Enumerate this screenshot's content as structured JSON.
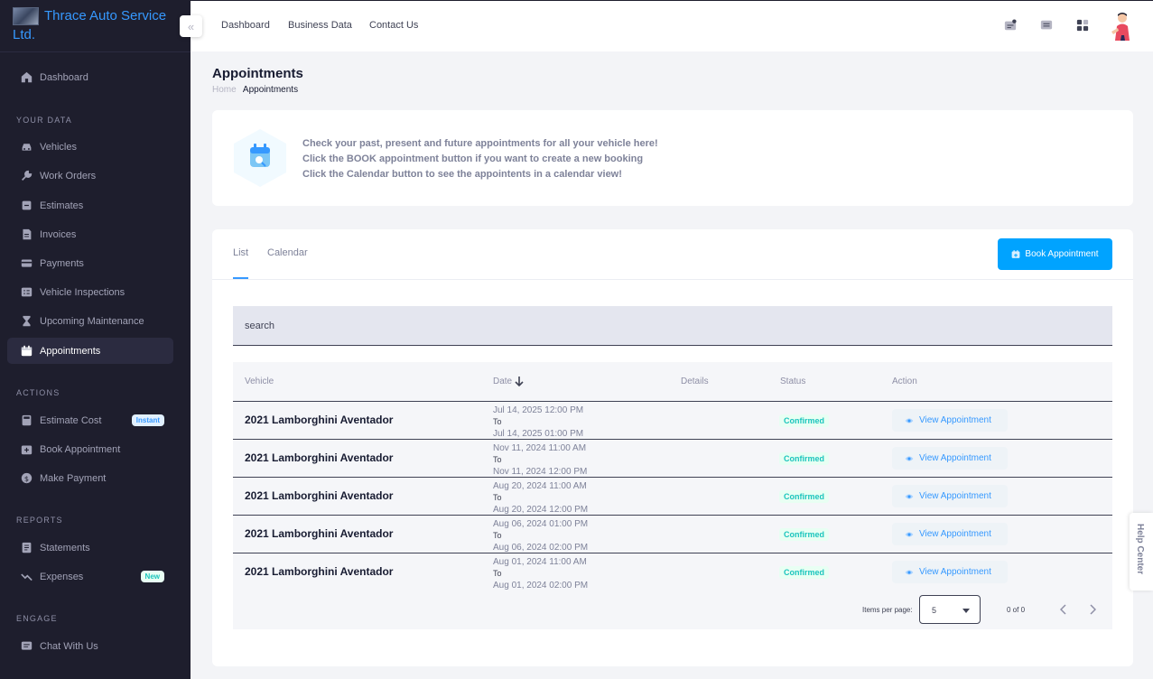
{
  "brand": {
    "name_line1": "Thrace Auto Service",
    "name_line2": "Ltd."
  },
  "sidebar": {
    "items": [
      {
        "label": "Dashboard",
        "icon": "home-icon"
      },
      {
        "label": "Vehicles",
        "icon": "car-icon"
      },
      {
        "label": "Work Orders",
        "icon": "wrench-icon"
      },
      {
        "label": "Estimates",
        "icon": "estimate-icon"
      },
      {
        "label": "Invoices",
        "icon": "invoice-icon"
      },
      {
        "label": "Payments",
        "icon": "payment-icon"
      },
      {
        "label": "Vehicle Inspections",
        "icon": "checklist-icon"
      },
      {
        "label": "Upcoming Maintenance",
        "icon": "hourglass-icon"
      },
      {
        "label": "Appointments",
        "icon": "calendar-icon",
        "active": true
      },
      {
        "label": "Estimate Cost",
        "icon": "calculator-icon",
        "badge": "Instant"
      },
      {
        "label": "Book Appointment",
        "icon": "book-icon"
      },
      {
        "label": "Make Payment",
        "icon": "dollar-icon"
      },
      {
        "label": "Statements",
        "icon": "statement-icon"
      },
      {
        "label": "Expenses",
        "icon": "expense-icon",
        "badge": "New"
      },
      {
        "label": "Chat With Us",
        "icon": "chat-icon"
      }
    ],
    "sections": {
      "your_data": "YOUR DATA",
      "actions": "ACTIONS",
      "reports": "REPORTS",
      "engage": "ENGAGE"
    }
  },
  "header": {
    "links": [
      "Dashboard",
      "Business Data",
      "Contact Us"
    ]
  },
  "page": {
    "title": "Appointments",
    "breadcrumb": {
      "home": "Home",
      "current": "Appointments"
    }
  },
  "info": {
    "line1": "Check your past, present and future appointments for all your vehicle here!",
    "line2": "Click the BOOK appointment button if you want to create a new booking",
    "line3": "Click the Calendar button to see the appointents in a calendar view!"
  },
  "tabs": {
    "list": "List",
    "calendar": "Calendar"
  },
  "book_button": "Book Appointment",
  "search": {
    "placeholder": "search"
  },
  "table": {
    "headers": {
      "vehicle": "Vehicle",
      "date": "Date",
      "details": "Details",
      "status": "Status",
      "action": "Action"
    },
    "rows": [
      {
        "vehicle": "2021 Lamborghini Aventador",
        "from": "Jul 14, 2025 12:00 PM",
        "to_label": "To",
        "to": "Jul 14, 2025 01:00 PM",
        "status": "Confirmed",
        "action": "View Appointment"
      },
      {
        "vehicle": "2021 Lamborghini Aventador",
        "from": "Nov 11, 2024 11:00 AM",
        "to_label": "To",
        "to": "Nov 11, 2024 12:00 PM",
        "status": "Confirmed",
        "action": "View Appointment"
      },
      {
        "vehicle": "2021 Lamborghini Aventador",
        "from": "Aug 20, 2024 11:00 AM",
        "to_label": "To",
        "to": "Aug 20, 2024 12:00 PM",
        "status": "Confirmed",
        "action": "View Appointment"
      },
      {
        "vehicle": "2021 Lamborghini Aventador",
        "from": "Aug 06, 2024 01:00 PM",
        "to_label": "To",
        "to": "Aug 06, 2024 02:00 PM",
        "status": "Confirmed",
        "action": "View Appointment"
      },
      {
        "vehicle": "2021 Lamborghini Aventador",
        "from": "Aug 01, 2024 11:00 AM",
        "to_label": "To",
        "to": "Aug 01, 2024 02:00 PM",
        "status": "Confirmed",
        "action": "View Appointment"
      }
    ]
  },
  "pagination": {
    "items_per_page_label": "Items per page:",
    "items_per_page": "5",
    "range": "0 of 0"
  },
  "help_center": "Help Center",
  "colors": {
    "accent": "#3699ff",
    "button": "#00a3ff",
    "sidebar_bg": "#1e1e2d",
    "confirmed": "#1bc5bd"
  }
}
